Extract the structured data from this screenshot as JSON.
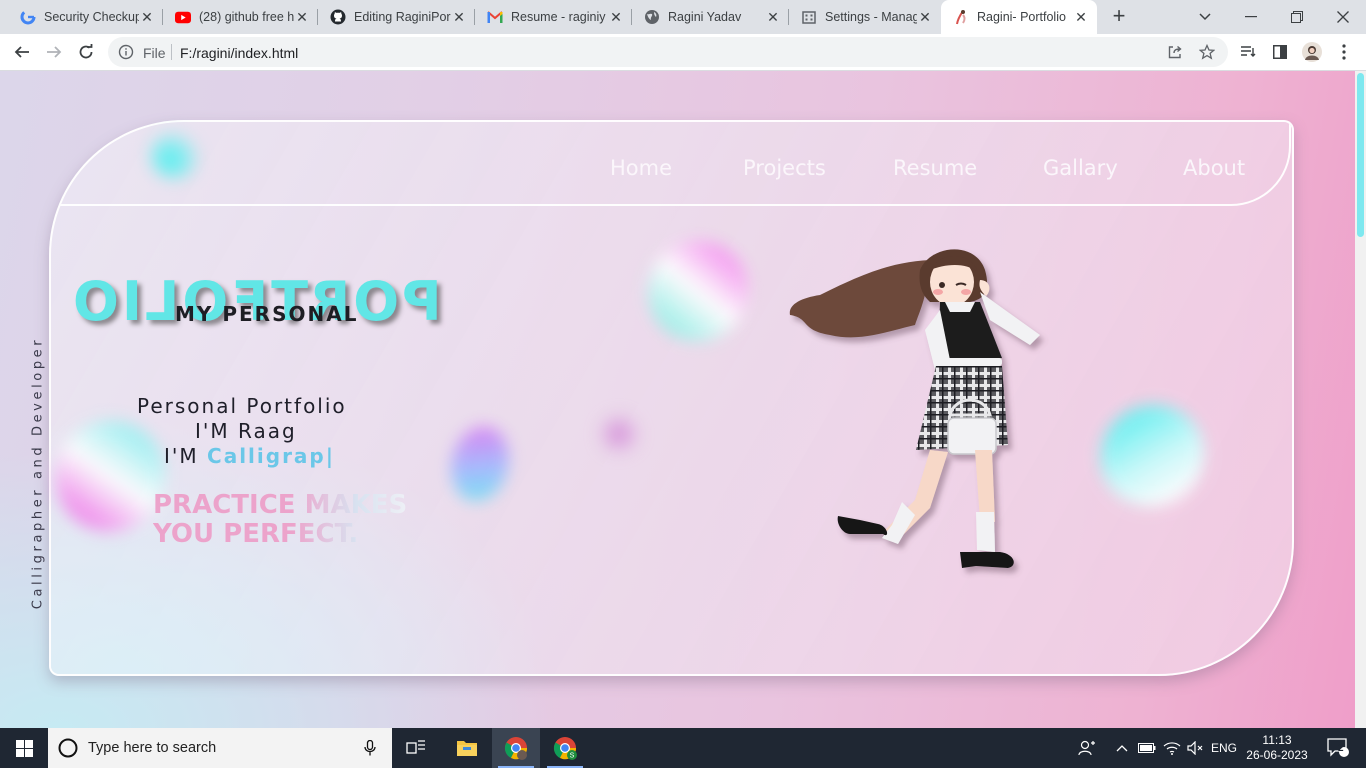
{
  "browser": {
    "tabs": [
      {
        "title": "Security Checkup",
        "icon": "google-icon"
      },
      {
        "title": "(28) github free h",
        "icon": "youtube-icon"
      },
      {
        "title": "Editing RaginiPor",
        "icon": "github-icon"
      },
      {
        "title": "Resume - raginiy",
        "icon": "gmail-icon"
      },
      {
        "title": "Ragini Yadav",
        "icon": "globe-icon"
      },
      {
        "title": "Settings - Manag",
        "icon": "building-icon"
      },
      {
        "title": "Ragini- Portfolio",
        "icon": "portfolio-favicon-icon",
        "active": true
      }
    ],
    "address": {
      "scheme_label": "File",
      "url": "F:/ragini/index.html"
    }
  },
  "page": {
    "nav": [
      "Home",
      "Projects",
      "Resume",
      "Gallary",
      "About"
    ],
    "side_text": "Calligrapher and Developer",
    "mirror_title": "PORTFOLIO",
    "my_personal": "MY PERSONAL",
    "intro_line1": "Personal Portfolio",
    "intro_line2": "I'M Raag",
    "intro_line3_prefix": "I'M",
    "typed_text": "Calligrap|",
    "quote_line1": "PRACTICE MAKES",
    "quote_line2": "YOU PERFECT.",
    "colors": {
      "accent_cyan": "#61e6e6",
      "accent_pink": "#eca3cb",
      "typed_blue": "#6bc7e8"
    }
  },
  "taskbar": {
    "search_placeholder": "Type here to search",
    "language": "ENG",
    "time": "11:13",
    "date": "26-06-2023",
    "notification_count": "2"
  }
}
